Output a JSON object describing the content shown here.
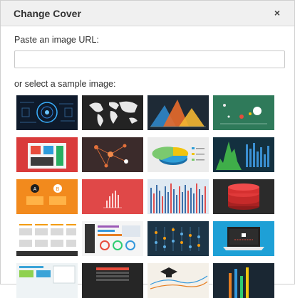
{
  "dialog": {
    "title": "Change Cover",
    "close_glyph": "×"
  },
  "url_section": {
    "label": "Paste an image URL:",
    "value": "",
    "placeholder": ""
  },
  "samples_section": {
    "label": "or select a sample image:"
  },
  "thumbnails": [
    {
      "name": "sample-thumb-tech-circuit",
      "bg": "#0e1a2b"
    },
    {
      "name": "sample-thumb-world-map",
      "bg": "#222222"
    },
    {
      "name": "sample-thumb-mountain-chart",
      "bg": "#1e2a36"
    },
    {
      "name": "sample-thumb-green-dots",
      "bg": "#2f7a5a"
    },
    {
      "name": "sample-thumb-red-infographic",
      "bg": "#d93b3b"
    },
    {
      "name": "sample-thumb-network-graph",
      "bg": "#3a2a2a"
    },
    {
      "name": "sample-thumb-3d-pie",
      "bg": "#e9e9e9"
    },
    {
      "name": "sample-thumb-forest-bars",
      "bg": "#13303f"
    },
    {
      "name": "sample-thumb-orange-ab",
      "bg": "#f28a1d"
    },
    {
      "name": "sample-thumb-red-bars",
      "bg": "#e04848"
    },
    {
      "name": "sample-thumb-blue-columns",
      "bg": "#dfe9f2"
    },
    {
      "name": "sample-thumb-red-stack",
      "bg": "#2b2b2b"
    },
    {
      "name": "sample-thumb-orange-grid",
      "bg": "#ffffff"
    },
    {
      "name": "sample-thumb-dashboard",
      "bg": "#f5f5f5"
    },
    {
      "name": "sample-thumb-orange-dots",
      "bg": "#1c3446"
    },
    {
      "name": "sample-thumb-laptop",
      "bg": "#1ea0d6"
    },
    {
      "name": "sample-thumb-light-infographic",
      "bg": "#eef3f5"
    },
    {
      "name": "sample-thumb-dark-table",
      "bg": "#262626"
    },
    {
      "name": "sample-thumb-graduation-line",
      "bg": "#f4f0e8"
    },
    {
      "name": "sample-thumb-dark-bars",
      "bg": "#1a2733"
    }
  ]
}
